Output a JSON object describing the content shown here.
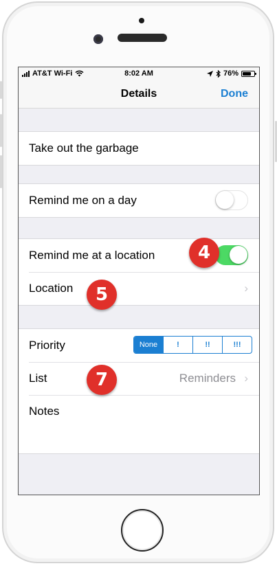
{
  "status_bar": {
    "carrier": "AT&T Wi-Fi",
    "time": "8:02 AM",
    "battery": "76%",
    "battery_level": 0.76
  },
  "nav": {
    "title": "Details",
    "done_label": "Done"
  },
  "task": {
    "title": "Take out the garbage"
  },
  "remind_day": {
    "label": "Remind me on a day",
    "enabled": false
  },
  "remind_location": {
    "label": "Remind me at a location",
    "enabled": true,
    "location_label": "Location"
  },
  "priority": {
    "label": "Priority",
    "options": [
      "None",
      "!",
      "!!",
      "!!!"
    ],
    "selected": "None"
  },
  "list": {
    "label": "List",
    "value": "Reminders"
  },
  "notes": {
    "label": "Notes"
  },
  "badges": [
    "4",
    "5",
    "7"
  ],
  "colors": {
    "accent": "#1b7fd2",
    "toggle_on": "#4cd964",
    "badge": "#e0302a"
  }
}
